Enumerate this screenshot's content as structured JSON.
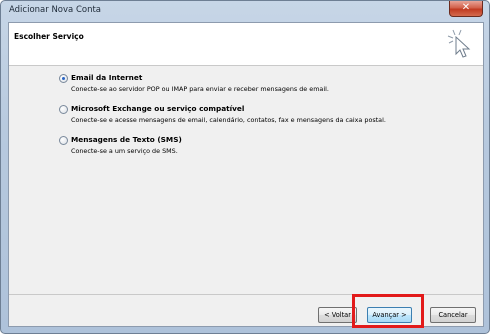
{
  "window": {
    "title": "Adicionar Nova Conta",
    "close_label": "✕"
  },
  "header": {
    "title": "Escolher Serviço"
  },
  "options": [
    {
      "label": "Email da Internet",
      "description": "Conecte-se ao servidor POP ou IMAP para enviar e receber mensagens de email.",
      "selected": true
    },
    {
      "label": "Microsoft Exchange ou serviço compatível",
      "description": "Conecte-se e acesse mensagens de email, calendário, contatos, fax e mensagens da caixa postal.",
      "selected": false
    },
    {
      "label": "Mensagens de Texto (SMS)",
      "description": "Conecte-se a um serviço de SMS.",
      "selected": false
    }
  ],
  "buttons": {
    "back": "< Voltar",
    "next": "Avançar >",
    "cancel": "Cancelar"
  },
  "colors": {
    "highlight": "#e21a1a",
    "accent": "#2a65c4"
  }
}
